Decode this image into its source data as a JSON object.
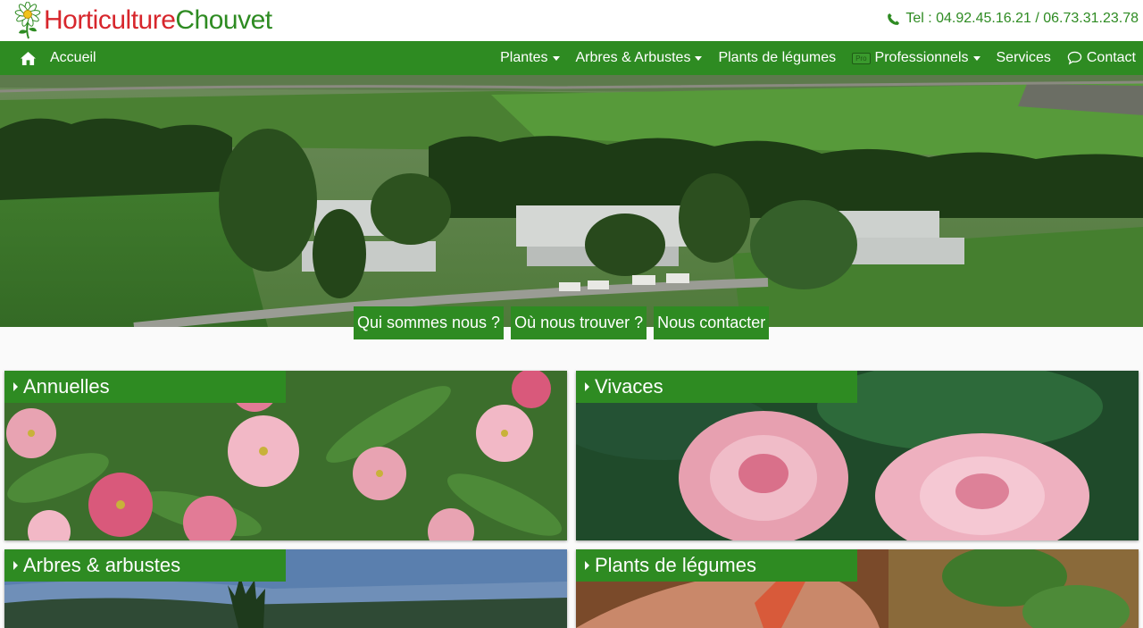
{
  "header": {
    "brand_part1": "Horticulture",
    "brand_part2": "Chouvet",
    "phone": "Tel : 04.92.45.16.21 / 06.73.31.23.78",
    "logo_icon": "daisy-flower-icon",
    "phone_icon": "phone-icon"
  },
  "nav": {
    "home_label": "Accueil",
    "items": [
      {
        "label": "Plantes",
        "dropdown": true
      },
      {
        "label": "Arbres & Arbustes",
        "dropdown": true
      },
      {
        "label": "Plants de légumes",
        "dropdown": false
      },
      {
        "label": "Professionnels",
        "dropdown": true,
        "badge": "Pro"
      },
      {
        "label": "Services",
        "dropdown": false
      },
      {
        "label": "Contact",
        "dropdown": false,
        "icon": "chat-bubble-icon"
      }
    ]
  },
  "hero": {
    "buttons": [
      "Qui sommes nous ?",
      "Où nous trouver ?",
      "Nous contacter"
    ]
  },
  "categories": [
    {
      "label": "Annuelles"
    },
    {
      "label": "Vivaces"
    },
    {
      "label": "Arbres & arbustes"
    },
    {
      "label": "Plants de légumes"
    }
  ],
  "colors": {
    "brand_green": "#2e8b22",
    "brand_red": "#d7262c",
    "page_background": "#fafafa"
  }
}
